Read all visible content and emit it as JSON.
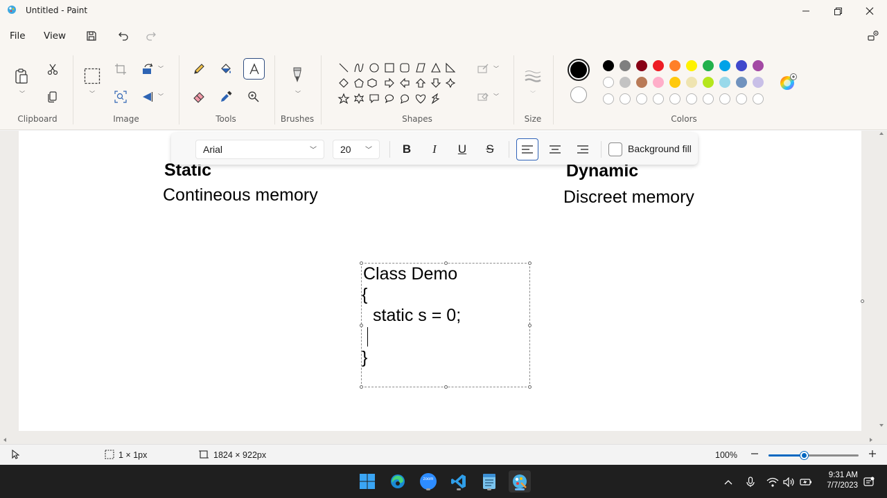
{
  "window": {
    "title": "Untitled - Paint"
  },
  "menu": {
    "file": "File",
    "view": "View"
  },
  "ribbon": {
    "groups": {
      "clipboard": "Clipboard",
      "image": "Image",
      "tools": "Tools",
      "brushes": "Brushes",
      "shapes": "Shapes",
      "size": "Size",
      "colors": "Colors"
    },
    "palette_row1": [
      "#000000",
      "#7f7f7f",
      "#880015",
      "#ed1c24",
      "#ff7f27",
      "#fff200",
      "#22b14c",
      "#00a2e8",
      "#3f48cc",
      "#a349a4"
    ],
    "palette_row2": [
      "#ffffff",
      "#c3c3c3",
      "#b97a57",
      "#ffaec9",
      "#ffc90e",
      "#efe4b0",
      "#b5e61d",
      "#99d9ea",
      "#7092be",
      "#c8bfe7"
    ],
    "primary_color": "#000000",
    "secondary_color": "#ffffff"
  },
  "text_toolbar": {
    "font": "Arial",
    "size": "20",
    "bold": "B",
    "italic": "I",
    "underline": "U",
    "strikethrough": "S",
    "background_fill": "Background fill",
    "alignment": "left"
  },
  "canvas": {
    "static_heading": "Static",
    "static_sub": "Contineous memory",
    "dynamic_heading": "Dynamic",
    "dynamic_sub": "Discreet memory",
    "code_lines": [
      "Class Demo",
      "{",
      "static s = 0;",
      "}"
    ]
  },
  "status": {
    "selection": "1 × 1px",
    "canvas_size": "1824 × 922px",
    "zoom": "100%",
    "zoom_level": 0.4
  },
  "taskbar": {
    "apps": [
      "windows-start",
      "edge",
      "zoom",
      "vscode",
      "notepad",
      "paint"
    ],
    "zoom_label": "zoom",
    "time": "9:31 AM",
    "date": "7/7/2023"
  }
}
